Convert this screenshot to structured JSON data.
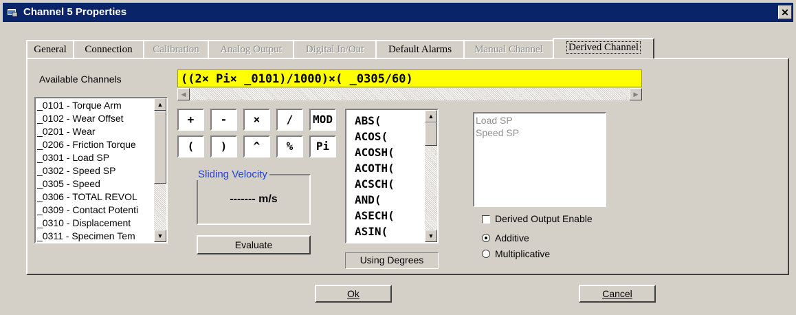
{
  "window": {
    "title": "Channel  5 Properties",
    "close_glyph": "✕"
  },
  "tabs": [
    {
      "label": "General",
      "enabled": true
    },
    {
      "label": "Connection",
      "enabled": true
    },
    {
      "label": "Calibration",
      "enabled": false
    },
    {
      "label": "Analog Output",
      "enabled": false
    },
    {
      "label": "Digital In/Out",
      "enabled": false
    },
    {
      "label": "Default Alarms",
      "enabled": true
    },
    {
      "label": "Manual Channel",
      "enabled": false
    },
    {
      "label": "Derived Channel",
      "enabled": true,
      "active": true
    }
  ],
  "derived": {
    "available_label": "Available Channels",
    "channels": [
      "_0101 - Torque Arm",
      "_0102 - Wear Offset",
      "_0201 - Wear",
      "_0206 - Friction Torque",
      "_0301 - Load SP",
      "_0302 - Speed SP",
      "_0305 - Speed",
      "_0306 - TOTAL REVOL",
      "_0309 - Contact Potenti",
      "_0310 - Displacement",
      "_0311 - Specimen Tem"
    ],
    "formula": "((2× Pi× _0101)/1000)×( _0305/60)",
    "keypad_row1": [
      "+",
      "-",
      "×",
      "/",
      "MOD"
    ],
    "keypad_row2": [
      "(",
      ")",
      "^",
      "%",
      "Pi"
    ],
    "group_title": "Sliding Velocity",
    "result": "------- m/s",
    "evaluate_label": "Evaluate",
    "functions": [
      "ABS(",
      "ACOS(",
      "ACOSH(",
      "ACOTH(",
      "ACSCH(",
      "AND(",
      "ASECH(",
      "ASIN("
    ],
    "using_degrees": "Using Degrees",
    "used_channels": [
      "Load SP",
      "Speed SP"
    ],
    "derived_output_label": "Derived Output Enable",
    "derived_output_checked": false,
    "mode_options": [
      "Additive",
      "Multiplicative"
    ],
    "mode_selected": "Additive"
  },
  "buttons": {
    "ok": "Ok",
    "cancel": "Cancel"
  },
  "colors": {
    "titlebar": "#0a246a",
    "formula_bg": "#ffff00",
    "group_title": "#2040d8",
    "face": "#d4d0c8"
  }
}
